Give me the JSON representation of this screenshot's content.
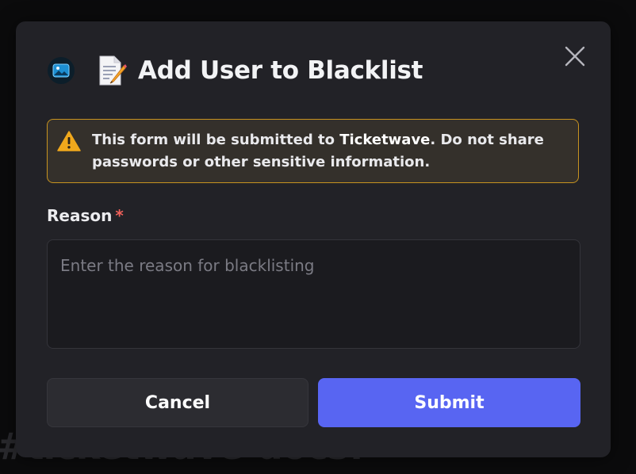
{
  "background": {
    "channel_text": "#ticketwave-docs!"
  },
  "modal": {
    "title": "Add User to Blacklist",
    "app_icon": "image-icon",
    "title_emoji": "memo-icon",
    "close_icon": "close-icon",
    "warning": {
      "icon": "warning-icon",
      "text_before": "This form will be submitted to ",
      "app_name": "Ticketwave",
      "text_after": ". Do not share passwords or other sensitive information.",
      "color": "#c79320"
    },
    "field": {
      "label": "Reason",
      "required_marker": "*",
      "placeholder": "Enter the reason for blacklisting",
      "value": ""
    },
    "buttons": {
      "cancel": "Cancel",
      "submit": "Submit"
    },
    "colors": {
      "accent": "#5865f2",
      "required": "#f0615a",
      "surface": "#222227"
    }
  }
}
